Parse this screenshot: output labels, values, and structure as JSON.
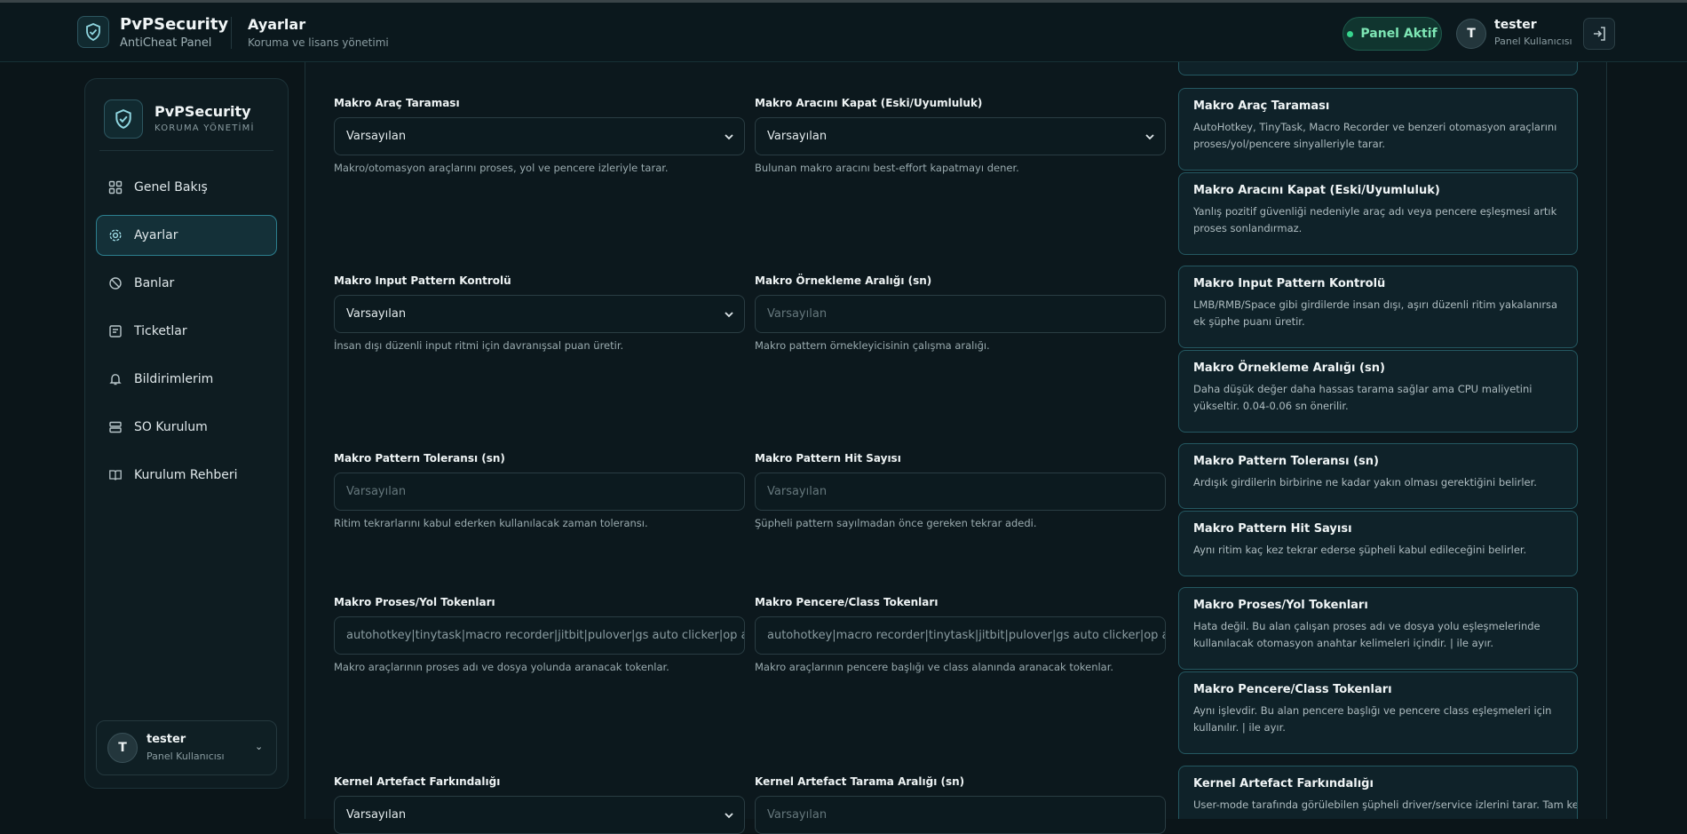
{
  "header": {
    "brand_name": "PvPSecurity",
    "brand_sub": "AntiCheat Panel",
    "page_title": "Ayarlar",
    "page_subtitle": "Koruma ve lisans yönetimi",
    "status_label": "Panel Aktif",
    "user_initial": "T",
    "user_name": "tester",
    "user_role": "Panel Kullanıcısı"
  },
  "sidebar": {
    "brand_name": "PvPSecurity",
    "brand_sub": "KORUMA YÖNETİMİ",
    "items": [
      {
        "label": "Genel Bakış",
        "icon": "grid-icon"
      },
      {
        "label": "Ayarlar",
        "icon": "gear-icon",
        "active": true
      },
      {
        "label": "Banlar",
        "icon": "ban-icon"
      },
      {
        "label": "Ticketlar",
        "icon": "ticket-icon"
      },
      {
        "label": "Bildirimlerim",
        "icon": "bell-icon"
      },
      {
        "label": "SO Kurulum",
        "icon": "server-icon"
      },
      {
        "label": "Kurulum Rehberi",
        "icon": "book-icon"
      }
    ],
    "user": {
      "initial": "T",
      "name": "tester",
      "role": "Panel Kullanıcısı"
    }
  },
  "fields": [
    {
      "label": "Makro Araç Taraması",
      "value": "Varsayılan",
      "type": "select",
      "help": "Makro/otomasyon araçlarını proses, yol ve pencere izleriyle tarar."
    },
    {
      "label": "Makro Aracını Kapat (Eski/Uyumluluk)",
      "value": "Varsayılan",
      "type": "select",
      "help": "Bulunan makro aracını best-effort kapatmayı dener."
    },
    {
      "label": "Makro Input Pattern Kontrolü",
      "value": "Varsayılan",
      "type": "select",
      "help": "İnsan dışı düzenli input ritmi için davranışsal puan üretir."
    },
    {
      "label": "Makro Örnekleme Aralığı (sn)",
      "placeholder": "Varsayılan",
      "type": "input",
      "help": "Makro pattern örnekleyicisinin çalışma aralığı."
    },
    {
      "label": "Makro Pattern Toleransı (sn)",
      "placeholder": "Varsayılan",
      "type": "input",
      "help": "Ritim tekrarlarını kabul ederken kullanılacak zaman toleransı."
    },
    {
      "label": "Makro Pattern Hit Sayısı",
      "placeholder": "Varsayılan",
      "type": "input",
      "help": "Şüpheli pattern sayılmadan önce gereken tekrar adedi."
    },
    {
      "label": "Makro Proses/Yol Tokenları",
      "value": "autohotkey|tinytask|macro recorder|jitbit|pulover|gs auto clicker|op auto clicker",
      "type": "input",
      "help": "Makro araçlarının proses adı ve dosya yolunda aranacak tokenlar."
    },
    {
      "label": "Makro Pencere/Class Tokenları",
      "value": "autohotkey|macro recorder|tinytask|jitbit|pulover|gs auto clicker|op auto clicker",
      "type": "input",
      "help": "Makro araçlarının pencere başlığı ve class alanında aranacak tokenlar."
    },
    {
      "label": "Kernel Artefact Farkındalığı",
      "value": "Varsayılan",
      "type": "select",
      "help": ""
    },
    {
      "label": "Kernel Artefact Tarama Aralığı (sn)",
      "placeholder": "Varsayılan",
      "type": "input",
      "help": ""
    }
  ],
  "info_cards": [
    {
      "title": "Makro Araç Taraması",
      "text": "AutoHotkey, TinyTask, Macro Recorder ve benzeri otomasyon araçlarını proses/yol/pencere sinyalleriyle tarar."
    },
    {
      "title": "Makro Aracını Kapat (Eski/Uyumluluk)",
      "text": "Yanlış pozitif güvenliği nedeniyle araç adı veya pencere eşleşmesi artık proses sonlandırmaz."
    },
    {
      "title": "Makro Input Pattern Kontrolü",
      "text": "LMB/RMB/Space gibi girdilerde insan dışı, aşırı düzenli ritim yakalanırsa ek şüphe puanı üretir."
    },
    {
      "title": "Makro Örnekleme Aralığı (sn)",
      "text": "Daha düşük değer daha hassas tarama sağlar ama CPU maliyetini yükseltir. 0.04-0.06 sn önerilir."
    },
    {
      "title": "Makro Pattern Toleransı (sn)",
      "text": "Ardışık girdilerin birbirine ne kadar yakın olması gerektiğini belirler."
    },
    {
      "title": "Makro Pattern Hit Sayısı",
      "text": "Aynı ritim kaç kez tekrar ederse şüpheli kabul edileceğini belirler."
    },
    {
      "title": "Makro Proses/Yol Tokenları",
      "text": "Hata değil. Bu alan çalışan proses adı ve dosya yolu eşleşmelerinde kullanılacak otomasyon anahtar kelimeleri içindir. | ile ayır."
    },
    {
      "title": "Makro Pencere/Class Tokenları",
      "text": "Aynı işlevdir. Bu alan pencere başlığı ve pencere class eşleşmeleri için kullanılır. | ile ayır."
    },
    {
      "title": "Kernel Artefact Farkındalığı",
      "text": "User-mode tarafında görülebilen şüpheli driver/service izlerini tarar. Tam kernel"
    }
  ],
  "colors": {
    "accent": "#2c7f8f",
    "status": "#37d58e",
    "bg": "#0b1519"
  }
}
